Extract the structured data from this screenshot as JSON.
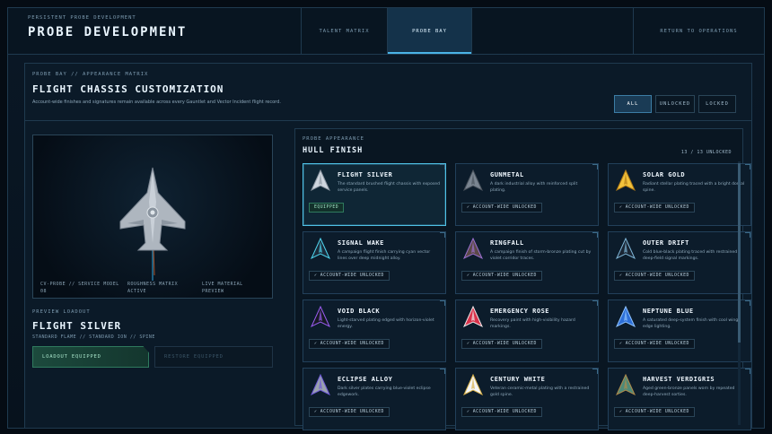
{
  "header": {
    "kicker": "PERSISTENT PROBE DEVELOPMENT",
    "title": "PROBE DEVELOPMENT",
    "tabs": [
      {
        "label": "TALENT MATRIX"
      },
      {
        "label": "PROBE BAY"
      },
      {
        "label": "RETURN TO OPERATIONS"
      }
    ]
  },
  "panel": {
    "kicker": "PROBE BAY // APPEARANCE MATRIX",
    "title": "FLIGHT CHASSIS CUSTOMIZATION",
    "description": "Account-wide finishes and signatures remain available across every Gauntlet and Vector Incident flight record.",
    "filters": [
      {
        "label": "ALL"
      },
      {
        "label": "UNLOCKED"
      },
      {
        "label": "LOCKED"
      }
    ]
  },
  "preview": {
    "meta": [
      {
        "line1": "CV-PROBE // SERVICE MODEL",
        "line2": "08"
      },
      {
        "line1": "ROUGHNESS MATRIX",
        "line2": "ACTIVE"
      },
      {
        "line1": "LIVE MATERIAL",
        "line2": "PREVIEW"
      }
    ],
    "loadout_kicker": "PREVIEW LOADOUT",
    "loadout_title": "FLIGHT SILVER",
    "loadout_sub": "STANDARD FLAME // STANDARD ION // SPINE",
    "equipped_label": "LOADOUT EQUIPPED",
    "restore_label": "RESTORE EQUIPPED"
  },
  "appearance": {
    "kicker": "PROBE APPEARANCE",
    "title": "HULL FINISH",
    "count": "13 / 13 UNLOCKED",
    "cards": [
      {
        "name": "FLIGHT SILVER",
        "desc": "The standard brushed flight chassis with exposed service panels.",
        "status": "EQUIPPED",
        "color": "#cfd6de",
        "accent": "#8d97a3"
      },
      {
        "name": "GUNMETAL",
        "desc": "A dark industrial alloy with reinforced split plating.",
        "status": "✓ ACCOUNT-WIDE UNLOCKED",
        "color": "#7a8591",
        "accent": "#4b545e"
      },
      {
        "name": "SOLAR GOLD",
        "desc": "Radiant stellar plating traced with a bright dorsal spine.",
        "status": "✓ ACCOUNT-WIDE UNLOCKED",
        "color": "#f2c23c",
        "accent": "#b07a16"
      },
      {
        "name": "SIGNAL WAKE",
        "desc": "A campaign flight finish carrying cyan vector lines over deep midnight alloy.",
        "status": "✓ ACCOUNT-WIDE UNLOCKED",
        "color": "#1c2b3a",
        "accent": "#4fd6f0"
      },
      {
        "name": "RINGFALL",
        "desc": "A campaign finish of storm-bronze plating cut by violet corridor traces.",
        "status": "✓ ACCOUNT-WIDE UNLOCKED",
        "color": "#5c4a48",
        "accent": "#9b6fd0"
      },
      {
        "name": "OUTER DRIFT",
        "desc": "Cold blue-black plating traced with restrained deep-field signal markings.",
        "status": "✓ ACCOUNT-WIDE UNLOCKED",
        "color": "#1a2533",
        "accent": "#7fb6d8"
      },
      {
        "name": "VOID BLACK",
        "desc": "Light-starved plating edged with horizon-violet energy.",
        "status": "✓ ACCOUNT-WIDE UNLOCKED",
        "color": "#161a22",
        "accent": "#9a5cf0"
      },
      {
        "name": "EMERGENCY ROSE",
        "desc": "Recovery paint with high-visibility hazard markings.",
        "status": "✓ ACCOUNT-WIDE UNLOCKED",
        "color": "#d8324a",
        "accent": "#f0e6e8"
      },
      {
        "name": "NEPTUNE BLUE",
        "desc": "A saturated deep-system finish with cool wing-edge lighting.",
        "status": "✓ ACCOUNT-WIDE UNLOCKED",
        "color": "#2d6fd8",
        "accent": "#8ec3ff"
      },
      {
        "name": "ECLIPSE ALLOY",
        "desc": "Dark silver plates carrying blue-violet eclipse edgework.",
        "status": "✓ ACCOUNT-WIDE UNLOCKED",
        "color": "#9aa3ad",
        "accent": "#6f5ad8"
      },
      {
        "name": "CENTURY WHITE",
        "desc": "Veteran ceramic-metal plating with a restrained gold spine.",
        "status": "✓ ACCOUNT-WIDE UNLOCKED",
        "color": "#f4f6f8",
        "accent": "#d8b14a"
      },
      {
        "name": "HARVEST VERDIGRIS",
        "desc": "Aged green-bronze panels worn by repeated deep-harvest sorties.",
        "status": "✓ ACCOUNT-WIDE UNLOCKED",
        "color": "#4f8a78",
        "accent": "#b08a4a"
      }
    ]
  }
}
